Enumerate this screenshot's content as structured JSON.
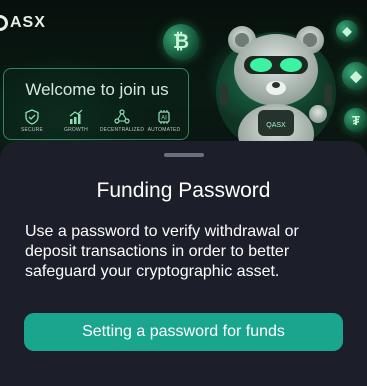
{
  "banner": {
    "logo_text": "ASX",
    "welcome_text": "Welcome to join us",
    "features": [
      {
        "label": "SECURE",
        "icon": "shield-check-icon"
      },
      {
        "label": "GROWTH",
        "icon": "growth-chart-icon"
      },
      {
        "label": "DECENTRALIZED",
        "icon": "decentralized-network-icon"
      },
      {
        "label": "AUTOMATED",
        "icon": "ai-chip-icon"
      }
    ],
    "coins": {
      "bitcoin": "₿",
      "ethereum": "◆",
      "tether": "₮"
    },
    "mascot_badge": "QASX"
  },
  "dialog": {
    "title": "Funding Password",
    "description": "Use a password to verify withdrawal or deposit transactions in order to better safeguard your cryptographic asset.",
    "primary_button": "Setting a password for funds"
  },
  "colors": {
    "sheet_background": "#1c1f2a",
    "accent": "#1aa58f",
    "banner_glow": "#3ad08a"
  }
}
